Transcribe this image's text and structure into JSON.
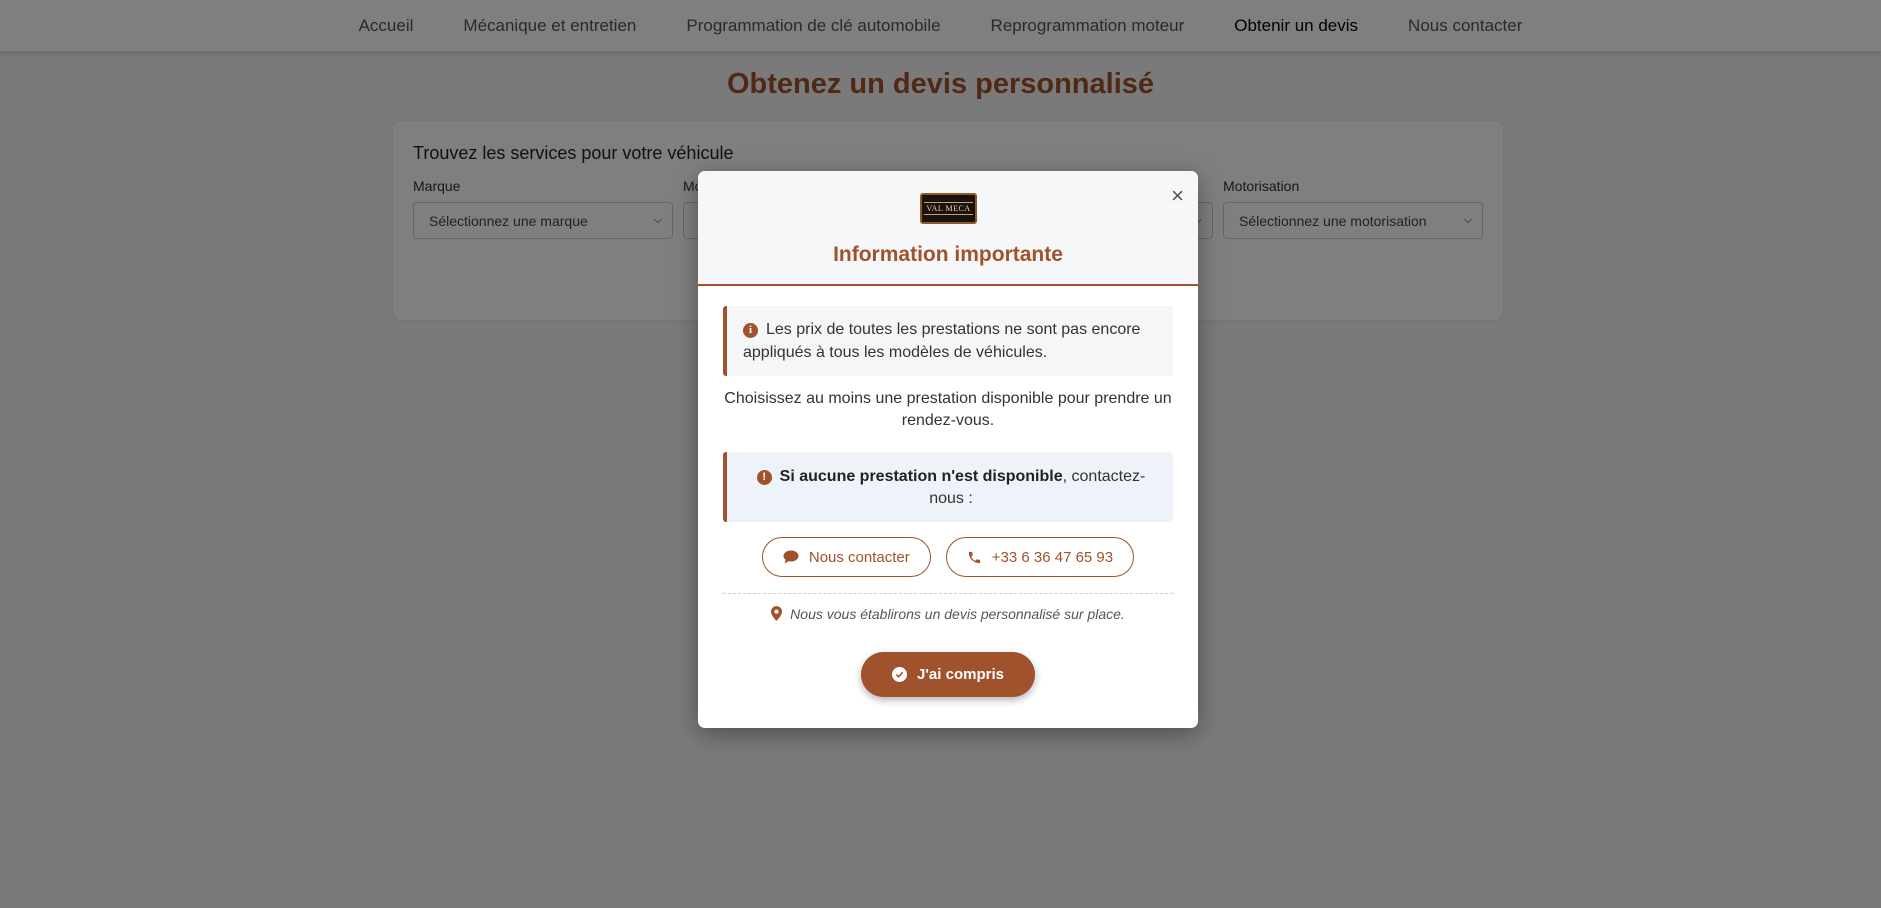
{
  "nav": {
    "items": [
      {
        "label": "Accueil"
      },
      {
        "label": "Mécanique et entretien"
      },
      {
        "label": "Programmation de clé automobile"
      },
      {
        "label": "Reprogrammation moteur"
      },
      {
        "label": "Obtenir un devis",
        "active": true
      },
      {
        "label": "Nous contacter"
      }
    ]
  },
  "page": {
    "title": "Obtenez un devis personnalisé"
  },
  "search": {
    "title": "Trouvez les services pour votre véhicule",
    "filters": [
      {
        "label": "Marque",
        "placeholder": "Sélectionnez une marque"
      },
      {
        "label": "Mo",
        "placeholder": ""
      },
      {
        "label": "",
        "placeholder": ""
      },
      {
        "label": "Motorisation",
        "placeholder": "Sélectionnez une motorisation"
      }
    ]
  },
  "modal": {
    "logo_text": "VAL MECA",
    "close": "×",
    "title": "Information importante",
    "alert1": "Les prix de toutes les prestations ne sont pas encore appliqués à tous les modèles de véhicules.",
    "prompt": "Choisissez au moins une prestation disponible pour prendre un rendez-vous.",
    "alert2_bold": "Si aucune prestation n'est disponible",
    "alert2_rest": ", contactez-nous :",
    "contact_label": "Nous contacter",
    "phone_label": "+33 6 36 47 65 93",
    "note": "Nous vous établirons un devis personnalisé sur place.",
    "confirm_label": "J'ai compris"
  },
  "colors": {
    "accent": "#a0522d",
    "overlay": "rgba(0,0,0,0.5)"
  }
}
